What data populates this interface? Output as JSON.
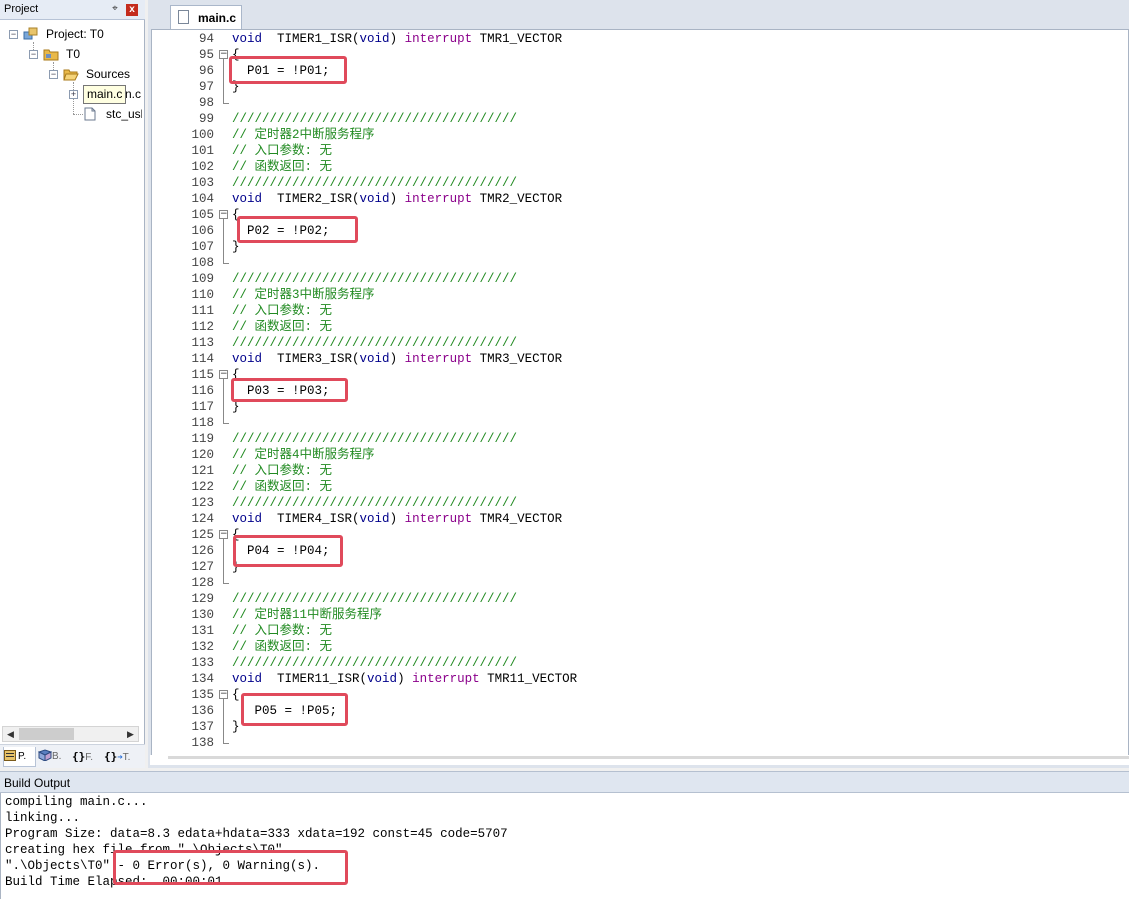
{
  "project_panel": {
    "title": "Project",
    "pin_glyph": "⌖",
    "close_glyph": "x",
    "tree": {
      "project_label": "Project: T0",
      "target_label": "T0",
      "group_label": "Sources",
      "file1_tooltip": "main.c",
      "file1_partial": "n.c",
      "file2_label": "stc_usl"
    },
    "tabs": [
      {
        "label": "P.",
        "icon": "project-icon"
      },
      {
        "label": "B.",
        "icon": "books-icon"
      },
      {
        "label": "F.",
        "icon": "functions-icon"
      },
      {
        "label": "T.",
        "icon": "templates-icon"
      }
    ]
  },
  "editor": {
    "tab_label": "main.c",
    "code_lines": [
      {
        "n": "94",
        "fold": "",
        "parts": [
          [
            "kw",
            "void"
          ],
          [
            "",
            "  TIMER1_ISR("
          ],
          [
            "kw",
            "void"
          ],
          [
            "",
            ") "
          ],
          [
            "kw2",
            "interrupt"
          ],
          [
            "",
            " TMR1_VECTOR"
          ]
        ]
      },
      {
        "n": "95",
        "fold": "box",
        "parts": [
          [
            "",
            "{"
          ]
        ]
      },
      {
        "n": "96",
        "fold": "line",
        "parts": [
          [
            "",
            "  P01 = !P01;"
          ]
        ]
      },
      {
        "n": "97",
        "fold": "line",
        "parts": [
          [
            "",
            "}"
          ]
        ]
      },
      {
        "n": "98",
        "fold": "end",
        "parts": []
      },
      {
        "n": "99",
        "fold": "",
        "parts": [
          [
            "cm",
            "//////////////////////////////////////"
          ]
        ]
      },
      {
        "n": "100",
        "fold": "",
        "parts": [
          [
            "cm",
            "// 定时器2中断服务程序"
          ]
        ]
      },
      {
        "n": "101",
        "fold": "",
        "parts": [
          [
            "cm",
            "// 入口参数: 无"
          ]
        ]
      },
      {
        "n": "102",
        "fold": "",
        "parts": [
          [
            "cm",
            "// 函数返回: 无"
          ]
        ]
      },
      {
        "n": "103",
        "fold": "",
        "parts": [
          [
            "cm",
            "//////////////////////////////////////"
          ]
        ]
      },
      {
        "n": "104",
        "fold": "",
        "parts": [
          [
            "kw",
            "void"
          ],
          [
            "",
            "  TIMER2_ISR("
          ],
          [
            "kw",
            "void"
          ],
          [
            "",
            ") "
          ],
          [
            "kw2",
            "interrupt"
          ],
          [
            "",
            " TMR2_VECTOR"
          ]
        ]
      },
      {
        "n": "105",
        "fold": "box",
        "parts": [
          [
            "",
            "{"
          ]
        ]
      },
      {
        "n": "106",
        "fold": "line",
        "parts": [
          [
            "",
            "  P02 = !P02;"
          ]
        ]
      },
      {
        "n": "107",
        "fold": "line",
        "parts": [
          [
            "",
            "}"
          ]
        ]
      },
      {
        "n": "108",
        "fold": "end",
        "parts": []
      },
      {
        "n": "109",
        "fold": "",
        "parts": [
          [
            "cm",
            "//////////////////////////////////////"
          ]
        ]
      },
      {
        "n": "110",
        "fold": "",
        "parts": [
          [
            "cm",
            "// 定时器3中断服务程序"
          ]
        ]
      },
      {
        "n": "111",
        "fold": "",
        "parts": [
          [
            "cm",
            "// 入口参数: 无"
          ]
        ]
      },
      {
        "n": "112",
        "fold": "",
        "parts": [
          [
            "cm",
            "// 函数返回: 无"
          ]
        ]
      },
      {
        "n": "113",
        "fold": "",
        "parts": [
          [
            "cm",
            "//////////////////////////////////////"
          ]
        ]
      },
      {
        "n": "114",
        "fold": "",
        "parts": [
          [
            "kw",
            "void"
          ],
          [
            "",
            "  TIMER3_ISR("
          ],
          [
            "kw",
            "void"
          ],
          [
            "",
            ") "
          ],
          [
            "kw2",
            "interrupt"
          ],
          [
            "",
            " TMR3_VECTOR"
          ]
        ]
      },
      {
        "n": "115",
        "fold": "box",
        "parts": [
          [
            "",
            "{"
          ]
        ]
      },
      {
        "n": "116",
        "fold": "line",
        "parts": [
          [
            "",
            "  P03 = !P03;"
          ]
        ]
      },
      {
        "n": "117",
        "fold": "line",
        "parts": [
          [
            "",
            "}"
          ]
        ]
      },
      {
        "n": "118",
        "fold": "end",
        "parts": []
      },
      {
        "n": "119",
        "fold": "",
        "parts": [
          [
            "cm",
            "//////////////////////////////////////"
          ]
        ]
      },
      {
        "n": "120",
        "fold": "",
        "parts": [
          [
            "cm",
            "// 定时器4中断服务程序"
          ]
        ]
      },
      {
        "n": "121",
        "fold": "",
        "parts": [
          [
            "cm",
            "// 入口参数: 无"
          ]
        ]
      },
      {
        "n": "122",
        "fold": "",
        "parts": [
          [
            "cm",
            "// 函数返回: 无"
          ]
        ]
      },
      {
        "n": "123",
        "fold": "",
        "parts": [
          [
            "cm",
            "//////////////////////////////////////"
          ]
        ]
      },
      {
        "n": "124",
        "fold": "",
        "parts": [
          [
            "kw",
            "void"
          ],
          [
            "",
            "  TIMER4_ISR("
          ],
          [
            "kw",
            "void"
          ],
          [
            "",
            ") "
          ],
          [
            "kw2",
            "interrupt"
          ],
          [
            "",
            " TMR4_VECTOR"
          ]
        ]
      },
      {
        "n": "125",
        "fold": "box",
        "parts": [
          [
            "",
            "{"
          ]
        ]
      },
      {
        "n": "126",
        "fold": "line",
        "parts": [
          [
            "",
            "  P04 = !P04;"
          ]
        ]
      },
      {
        "n": "127",
        "fold": "line",
        "parts": [
          [
            "",
            "}"
          ]
        ]
      },
      {
        "n": "128",
        "fold": "end",
        "parts": []
      },
      {
        "n": "129",
        "fold": "",
        "parts": [
          [
            "cm",
            "//////////////////////////////////////"
          ]
        ]
      },
      {
        "n": "130",
        "fold": "",
        "parts": [
          [
            "cm",
            "// 定时器11中断服务程序"
          ]
        ]
      },
      {
        "n": "131",
        "fold": "",
        "parts": [
          [
            "cm",
            "// 入口参数: 无"
          ]
        ]
      },
      {
        "n": "132",
        "fold": "",
        "parts": [
          [
            "cm",
            "// 函数返回: 无"
          ]
        ]
      },
      {
        "n": "133",
        "fold": "",
        "parts": [
          [
            "cm",
            "//////////////////////////////////////"
          ]
        ]
      },
      {
        "n": "134",
        "fold": "",
        "parts": [
          [
            "kw",
            "void"
          ],
          [
            "",
            "  TIMER11_ISR("
          ],
          [
            "kw",
            "void"
          ],
          [
            "",
            ") "
          ],
          [
            "kw2",
            "interrupt"
          ],
          [
            "",
            " TMR11_VECTOR"
          ]
        ]
      },
      {
        "n": "135",
        "fold": "box",
        "parts": [
          [
            "",
            "{"
          ]
        ]
      },
      {
        "n": "136",
        "fold": "line",
        "parts": [
          [
            "",
            "   P05 = !P05;"
          ]
        ]
      },
      {
        "n": "137",
        "fold": "line",
        "parts": [
          [
            "",
            "}"
          ]
        ]
      },
      {
        "n": "138",
        "fold": "end",
        "parts": []
      }
    ]
  },
  "build_output": {
    "title": "Build Output",
    "lines": [
      "compiling main.c...",
      "linking...",
      "Program Size: data=8.3 edata+hdata=333 xdata=192 const=45 code=5707",
      "creating hex file from \".\\Objects\\T0\"...",
      "\".\\Objects\\T0\" - 0 Error(s), 0 Warning(s).",
      "Build Time Elapsed:  00:00:01"
    ]
  },
  "colors": {
    "keyword": "#00008b",
    "interrupt_keyword": "#8b008b",
    "comment": "#228b22",
    "highlight_box": "#e04a5b"
  }
}
